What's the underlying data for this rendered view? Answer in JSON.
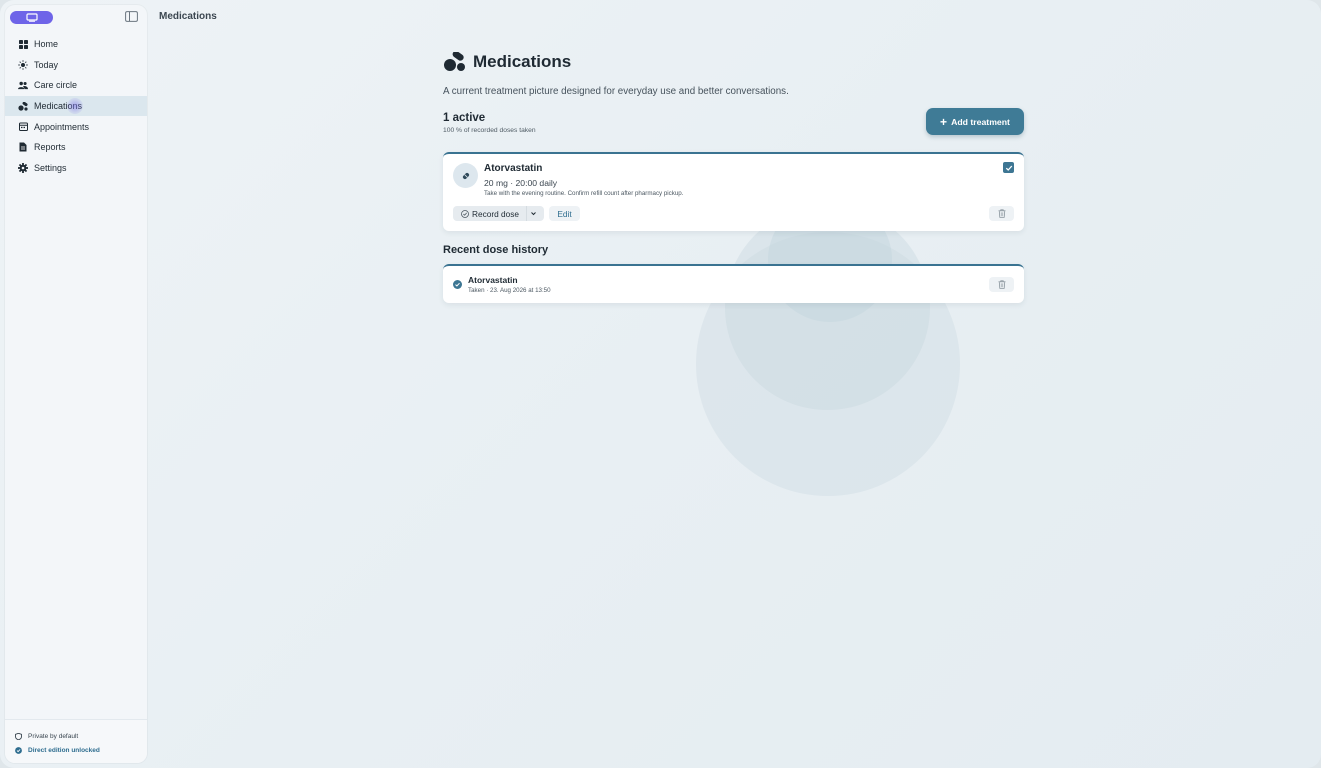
{
  "page": {
    "header_title": "Medications"
  },
  "sidebar": {
    "items": [
      {
        "label": "Home",
        "icon": "home-grid-icon"
      },
      {
        "label": "Today",
        "icon": "sun-icon"
      },
      {
        "label": "Care circle",
        "icon": "people-icon"
      },
      {
        "label": "Medications",
        "icon": "pills-icon",
        "active": true
      },
      {
        "label": "Appointments",
        "icon": "calendar-icon"
      },
      {
        "label": "Reports",
        "icon": "document-icon"
      },
      {
        "label": "Settings",
        "icon": "gear-icon"
      }
    ],
    "footer": {
      "private_label": "Private by default",
      "unlocked_label": "Direct edition unlocked"
    }
  },
  "main": {
    "title": "Medications",
    "subtitle": "A current treatment picture designed for everyday use and better conversations.",
    "active_count": "1 active",
    "doses_taken": "100 % of recorded doses taken",
    "add_button_label": "Add treatment",
    "medication": {
      "name": "Atorvastatin",
      "dose": "20 mg · 20:00 daily",
      "note": "Take with the evening routine. Confirm refill count after pharmacy pickup.",
      "record_label": "Record dose",
      "edit_label": "Edit"
    },
    "history_title": "Recent dose history",
    "history": [
      {
        "name": "Atorvastatin",
        "meta": "Taken · 23. Aug 2026 at 13:50"
      }
    ]
  },
  "colors": {
    "accent": "#3f7b96",
    "brand": "#6e64e8",
    "card_border": "#3a7391"
  }
}
